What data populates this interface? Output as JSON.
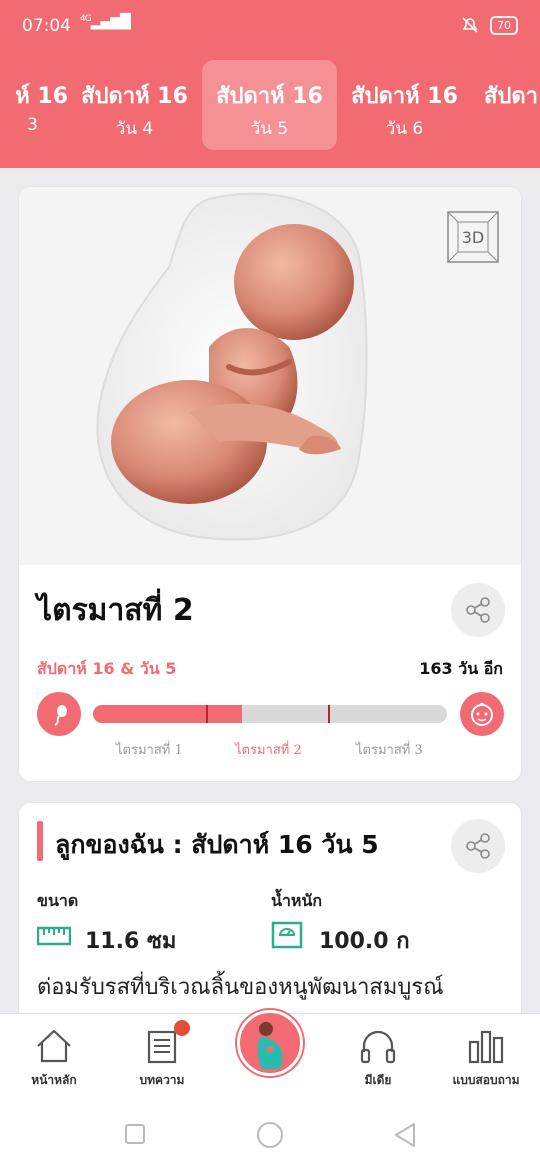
{
  "status": {
    "time": "07:04",
    "signal": "4G",
    "battery": "70"
  },
  "week_tabs": [
    {
      "week": "ห์ 16",
      "day": "3"
    },
    {
      "week": "สัปดาห์ 16",
      "day": "วัน 4"
    },
    {
      "week": "สัปดาห์ 16",
      "day": "วัน 5"
    },
    {
      "week": "สัปดาห์ 16",
      "day": "วัน 6"
    },
    {
      "week": "สัปดา",
      "day": ""
    }
  ],
  "badge_3d": "3D",
  "trimester_card": {
    "title": "ไตรมาสที่ 2",
    "week_day": "สัปดาห์ 16 & วัน 5",
    "days_left": "163 วัน อีก",
    "progress": 0.42,
    "trimester_labels": [
      "ไตรมาสที่ 1",
      "ไตรมาสที่ 2",
      "ไตรมาสที่ 3"
    ]
  },
  "baby_card": {
    "title": "ลูกของฉัน : สัปดาห์ 16 วัน 5",
    "size_label": "ขนาด",
    "size_value": "11.6 ซม",
    "weight_label": "น้ำหนัก",
    "weight_value": "100.0 ก",
    "description": "ต่อมรับรสที่บริเวณลิ้นของหนูพัฒนาสมบูรณ์"
  },
  "nav": {
    "home": "หน้าหลัก",
    "articles": "บทความ",
    "media": "มีเดีย",
    "quiz": "แบบสอบถาม"
  },
  "colors": {
    "accent": "#F26B72",
    "notif": "#E24E3A"
  }
}
